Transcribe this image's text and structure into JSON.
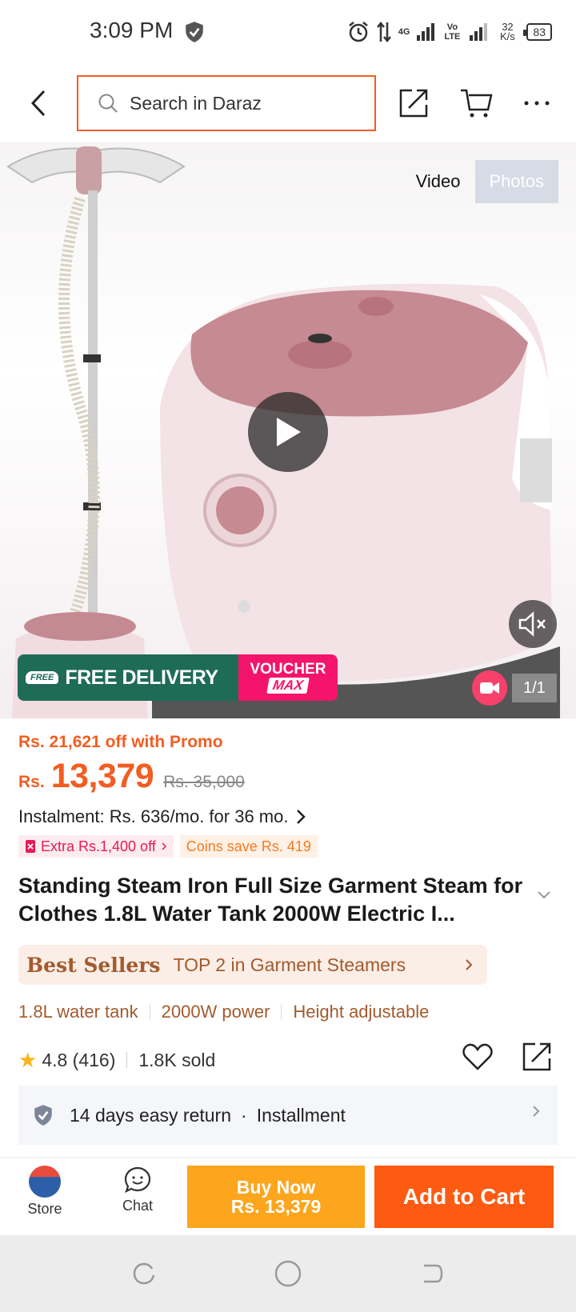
{
  "status": {
    "time": "3:09 PM",
    "network_4g": "4G",
    "volte": "Vo LTE",
    "speed": "32 K/s",
    "battery": "83"
  },
  "header": {
    "search_placeholder": "Search in Daraz"
  },
  "gallery": {
    "video_tab": "Video",
    "photos_tab": "Photos",
    "free_badge": "FREE",
    "free_delivery": "FREE DELIVERY",
    "voucher_1": "VOUCHER",
    "voucher_2": "MAX",
    "counter": "1/1"
  },
  "pricing": {
    "promo": "Rs. 21,621 off with Promo",
    "currency": "Rs.",
    "price": "13,379",
    "original": "Rs. 35,000",
    "instalment": "Instalment: Rs. 636/mo. for 36 mo.",
    "extra_tag": "Extra Rs.1,400 off",
    "coins_tag": "Coins save Rs. 419"
  },
  "product": {
    "title": "Standing Steam Iron Full Size Garment Steam for Clothes 1.8L Water Tank 2000W Electric I...",
    "best_seller_logo": "Best Sellers",
    "best_seller_text": "TOP 2 in Garment Steamers",
    "features": [
      "1.8L water tank",
      "2000W power",
      "Height adjustable"
    ],
    "rating": "4.8 (416)",
    "sold": "1.8K sold"
  },
  "service": {
    "return": "14 days easy return",
    "installment": "Installment"
  },
  "bottom": {
    "store": "Store",
    "chat": "Chat",
    "buy_now": "Buy Now",
    "buy_price": "Rs. 13,379",
    "add_to_cart": "Add to Cart"
  },
  "colors": {
    "brand_orange": "#f25d22",
    "buy_now": "#fda51d",
    "add_cart": "#fd5a12",
    "free_delivery": "#1e6b56",
    "voucher": "#f5146c"
  }
}
